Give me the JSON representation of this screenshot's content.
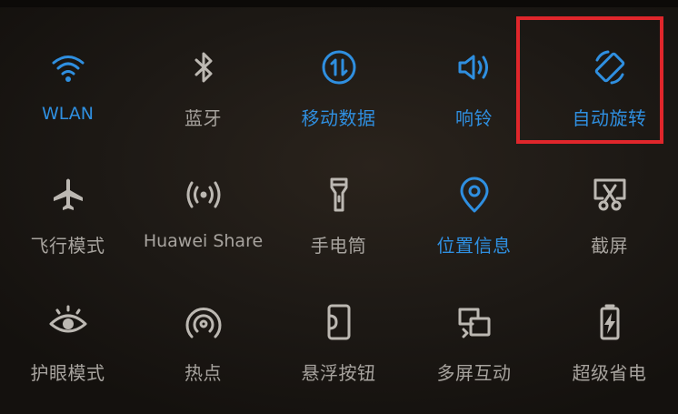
{
  "tiles": [
    {
      "id": "wlan",
      "label": "WLAN",
      "icon": "wifi-icon",
      "active": true
    },
    {
      "id": "bluetooth",
      "label": "蓝牙",
      "icon": "bluetooth-icon",
      "active": false
    },
    {
      "id": "mobile-data",
      "label": "移动数据",
      "icon": "mobile-data-icon",
      "active": true
    },
    {
      "id": "ringer",
      "label": "响铃",
      "icon": "speaker-icon",
      "active": true
    },
    {
      "id": "auto-rotate",
      "label": "自动旋转",
      "icon": "auto-rotate-icon",
      "active": true
    },
    {
      "id": "airplane",
      "label": "飞行模式",
      "icon": "airplane-icon",
      "active": false
    },
    {
      "id": "huawei-share",
      "label": "Huawei Share",
      "icon": "huawei-share-icon",
      "active": false
    },
    {
      "id": "flashlight",
      "label": "手电筒",
      "icon": "flashlight-icon",
      "active": false
    },
    {
      "id": "location",
      "label": "位置信息",
      "icon": "location-pin-icon",
      "active": true
    },
    {
      "id": "screenshot",
      "label": "截屏",
      "icon": "screenshot-scissors-icon",
      "active": false
    },
    {
      "id": "eye-comfort",
      "label": "护眼模式",
      "icon": "eye-icon",
      "active": false
    },
    {
      "id": "hotspot",
      "label": "热点",
      "icon": "hotspot-icon",
      "active": false
    },
    {
      "id": "floating-dock",
      "label": "悬浮按钮",
      "icon": "floating-button-icon",
      "active": false
    },
    {
      "id": "multi-screen",
      "label": "多屏互动",
      "icon": "multi-screen-icon",
      "active": false
    },
    {
      "id": "power-saving",
      "label": "超级省电",
      "icon": "battery-bolt-icon",
      "active": false
    }
  ],
  "colors": {
    "active": "#2f8fe0",
    "inactive": "#a7a39e",
    "highlight": "#e0262b"
  }
}
